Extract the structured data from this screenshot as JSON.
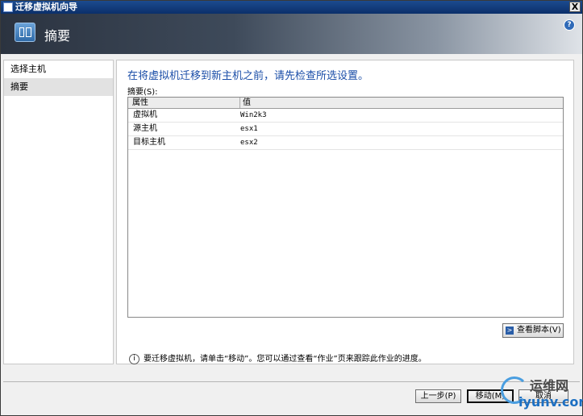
{
  "window": {
    "title": "迁移虚拟机向导",
    "close_label": "X"
  },
  "banner": {
    "title": "摘要",
    "help_label": "?"
  },
  "nav": {
    "items": [
      {
        "label": "选择主机",
        "selected": false
      },
      {
        "label": "摘要",
        "selected": true
      }
    ]
  },
  "content": {
    "heading": "在将虚拟机迁移到新主机之前，请先检查所选设置。",
    "table_label": "摘要(S):",
    "columns": [
      "属性",
      "值"
    ],
    "rows": [
      {
        "property": "虚拟机",
        "value": "Win2k3"
      },
      {
        "property": "源主机",
        "value": "esx1"
      },
      {
        "property": "目标主机",
        "value": "esx2"
      }
    ],
    "view_script_label": "查看脚本(V)",
    "info_text": "要迁移虚拟机，请单击“移动”。您可以通过查看“作业”页来跟踪此作业的进度。"
  },
  "footer": {
    "back_label": "上一步(P)",
    "move_label": "移动(M)",
    "cancel_label": "取消"
  },
  "watermark": {
    "top_text": "运维网",
    "bottom_text": "iyunv.com"
  },
  "icons": {
    "app": "window-icon",
    "banner": "wizard-summary-icon",
    "help": "help-icon",
    "script": "powershell-icon",
    "info": "info-icon"
  }
}
